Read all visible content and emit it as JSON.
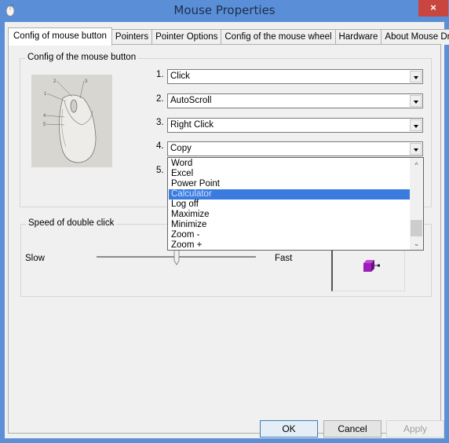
{
  "window": {
    "title": "Mouse Properties",
    "close_label": "×"
  },
  "tabs": [
    {
      "label": "Config of mouse button",
      "active": true
    },
    {
      "label": "Pointers",
      "active": false
    },
    {
      "label": "Pointer Options",
      "active": false
    },
    {
      "label": "Config of the mouse wheel",
      "active": false
    },
    {
      "label": "Hardware",
      "active": false
    },
    {
      "label": "About Mouse Driver",
      "active": false
    }
  ],
  "button_config": {
    "group_label": "Config of the mouse button",
    "image_callouts": [
      "1",
      "2",
      "3",
      "4",
      "5"
    ],
    "rows": [
      {
        "number": "1.",
        "value": "Click"
      },
      {
        "number": "2.",
        "value": "AutoScroll"
      },
      {
        "number": "3.",
        "value": "Right Click"
      },
      {
        "number": "4.",
        "value": "Copy"
      },
      {
        "number": "5.",
        "value": ""
      }
    ],
    "open_dropdown": {
      "items": [
        "Word",
        "Excel",
        "Power Point",
        "Calculator",
        "Log off",
        "Maximize",
        "Minimize",
        "Zoom -",
        "Zoom +"
      ],
      "selected": "Calculator"
    }
  },
  "double_click": {
    "group_label": "Speed of double click",
    "slow_label": "Slow",
    "fast_label": "Fast",
    "slider_value_fraction": 0.5
  },
  "buttons": {
    "ok": "OK",
    "cancel": "Cancel",
    "apply": "Apply"
  },
  "colors": {
    "titlebar": "#5a8fd8",
    "close": "#c8463f",
    "selection": "#3a7be0",
    "test_cube": "#9b1fb8"
  }
}
